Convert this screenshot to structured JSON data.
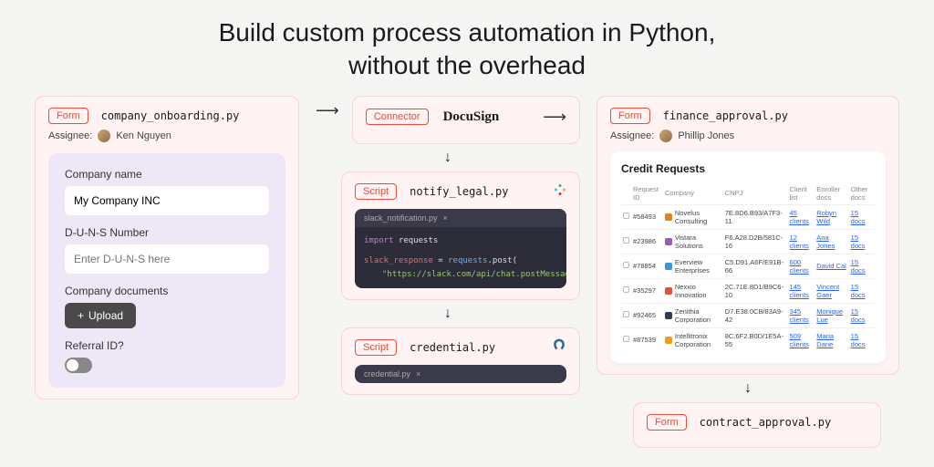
{
  "hero": {
    "line1": "Build custom process automation in Python,",
    "line2": "without the overhead"
  },
  "col1": {
    "tag": "Form",
    "file": "company_onboarding.py",
    "assignee_label": "Assignee:",
    "assignee_name": "Ken Nguyen",
    "form": {
      "company_label": "Company name",
      "company_value": "My Company INC",
      "duns_label": "D-U-N-S Number",
      "duns_placeholder": "Enter D-U-N-S here",
      "docs_label": "Company documents",
      "upload_label": "Upload",
      "referral_label": "Referral ID?"
    }
  },
  "col2": {
    "connector_tag": "Connector",
    "connector_name": "DocuSign",
    "script1_tag": "Script",
    "script1_file": "notify_legal.py",
    "script1_tab": "slack_notification.py",
    "script1_code": {
      "l1_kw": "import",
      "l1_mod": "requests",
      "l2_var": "slack_response",
      "l2_op": " = ",
      "l2_mod": "requests",
      "l2_fn": ".post(",
      "l3_str": "\"https://slack.com/api/chat.postMessage\""
    },
    "script2_tag": "Script",
    "script2_file": "credential.py",
    "script2_tab": "credential.py"
  },
  "col3": {
    "form1_tag": "Form",
    "form1_file": "finance_approval.py",
    "assignee_label": "Assignee:",
    "assignee_name": "Phillip Jones",
    "table_title": "Credit Requests",
    "headers": [
      "",
      "Request ID",
      "Company",
      "CNPJ",
      "Client list",
      "Enroller docs",
      "Other docs"
    ],
    "rows": [
      {
        "id": "#58493",
        "company": "Novelus Consulting",
        "cnpj": "7E.8D6.B93/A7F3-11",
        "clients": "45 clients",
        "enroller": "Robyn Wild",
        "docs": "15 docs",
        "color": "#e67e22"
      },
      {
        "id": "#23986",
        "company": "Vistara Solutions",
        "cnpj": "F6.A28.D2B/581C-16",
        "clients": "12 clients",
        "enroller": "Ana Jones",
        "docs": "15 docs",
        "color": "#9b59b6"
      },
      {
        "id": "#78854",
        "company": "Everview Enterprises",
        "cnpj": "C5.D91.A6F/E91B-66",
        "clients": "600 clients",
        "enroller": "David Cal",
        "docs": "15 docs",
        "color": "#3498db"
      },
      {
        "id": "#35297",
        "company": "Nexxio Innovation",
        "cnpj": "2C.71E.8D1/B9C6-10",
        "clients": "145 clients",
        "enroller": "Vincent Gaer",
        "docs": "15 docs",
        "color": "#e74c3c"
      },
      {
        "id": "#92465",
        "company": "Zenithia Corporation",
        "cnpj": "D7.E38.0CB/83A9-42",
        "clients": "345 clients",
        "enroller": "Monique Lue",
        "docs": "15 docs",
        "color": "#2c3e50"
      },
      {
        "id": "#87539",
        "company": "Intellitronix Corporation",
        "cnpj": "8C.6F2.B0D/1E5A-55",
        "clients": "509 clients",
        "enroller": "Maria Dane",
        "docs": "15 docs",
        "color": "#f39c12"
      }
    ],
    "form2_tag": "Form",
    "form2_file": "contract_approval.py"
  }
}
